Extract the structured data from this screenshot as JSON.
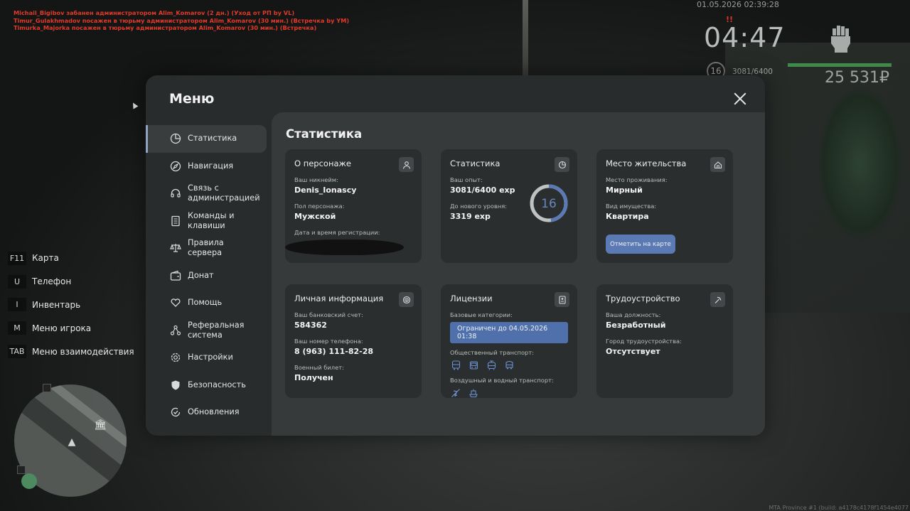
{
  "chat": [
    "Michail_Bigibov забанен администратором Alim_Komarov (2 дн.) (Уход от РП by VL)",
    "Timur_Gulakhmadov посажен в тюрьму администратором Alim_Komarov (30 мин.) (Встречка by YM)",
    "Timurka_Majorka посажен в тюрьму администратором Alim_Komarov (30 мин.) (Встречка)"
  ],
  "hud": {
    "datetime": "01.05.2026 02:39:28",
    "time": "04:47",
    "wanted": "!!",
    "level": "16",
    "exp": "3081/6400",
    "health_fraction": 1.0,
    "money": "25 531₽"
  },
  "keybinds": [
    {
      "key": "F11",
      "label": "Карта"
    },
    {
      "key": "U",
      "label": "Телефон"
    },
    {
      "key": "I",
      "label": "Инвентарь"
    },
    {
      "key": "M",
      "label": "Меню игрока"
    },
    {
      "key": "TAB",
      "label": "Меню взаимодействия"
    }
  ],
  "footer": "MTA Province #1 (build: a4178c4178f1454e4077",
  "menu": {
    "title": "Меню",
    "sidebar": [
      {
        "label": "Статистика",
        "icon": "pie-chart-icon",
        "active": true
      },
      {
        "label": "Навигация",
        "icon": "compass-icon"
      },
      {
        "label": "Связь с администрацией",
        "icon": "headset-icon"
      },
      {
        "label": "Команды и клавиши",
        "icon": "document-icon"
      },
      {
        "label": "Правила сервера",
        "icon": "scales-icon"
      },
      {
        "label": "Донат",
        "icon": "wallet-icon"
      },
      {
        "label": "Помощь",
        "icon": "heart-hands-icon"
      },
      {
        "label": "Реферальная система",
        "icon": "network-icon"
      },
      {
        "label": "Настройки",
        "icon": "gear-icon"
      },
      {
        "label": "Безопасность",
        "icon": "shield-icon"
      },
      {
        "label": "Обновления",
        "icon": "refresh-check-icon"
      }
    ],
    "content_title": "Статистика",
    "cards": {
      "character": {
        "title": "О персонаже",
        "nick_label": "Ваш никнейм:",
        "nick": "Denis_Ionascy",
        "gender_label": "Пол персонажа:",
        "gender": "Мужской",
        "reg_label": "Дата и время регистрации:"
      },
      "stats": {
        "title": "Статистика",
        "exp_label": "Ваш опыт:",
        "exp": "3081/6400 exp",
        "next_label": "До нового уровня:",
        "next": "3319 exp",
        "level": "16",
        "level_progress": 0.48
      },
      "residence": {
        "title": "Место жительства",
        "place_label": "Место проживания:",
        "place": "Мирный",
        "property_label": "Вид имущества:",
        "property": "Квартира",
        "map_button": "Отметить на карте"
      },
      "personal": {
        "title": "Личная информация",
        "bank_label": "Ваш банковский счет:",
        "bank": "584362",
        "phone_label": "Ваш номер телефона:",
        "phone": "8 (963) 111-82-28",
        "military_label": "Военный билет:",
        "military": "Получен"
      },
      "licenses": {
        "title": "Лицензии",
        "base_label": "Базовые категории:",
        "base_badge": "Ограничен до 04.05.2026 01:38",
        "public_label": "Общественный транспорт:",
        "air_label": "Воздушный и водный транспорт:"
      },
      "job": {
        "title": "Трудоустройство",
        "position_label": "Ваша должность:",
        "position": "Безработный",
        "city_label": "Город трудоустройства:",
        "city": "Отсутствует"
      }
    }
  }
}
